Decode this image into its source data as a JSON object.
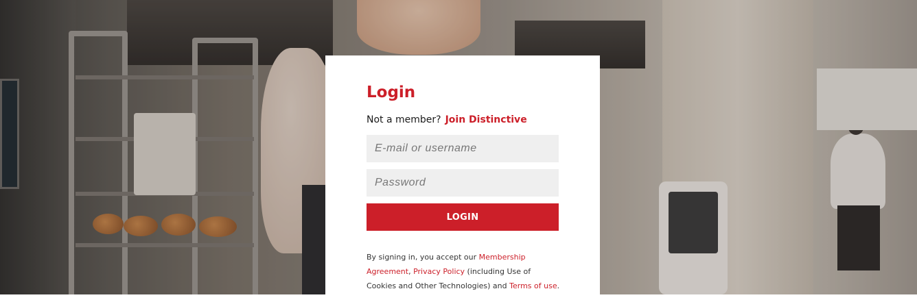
{
  "login": {
    "title": "Login",
    "not_member_text": "Not a member?",
    "join_link": "Join Distinctive",
    "email_placeholder": "E-mail or username",
    "password_placeholder": "Password",
    "button_label": "LOGIN"
  },
  "legal": {
    "prefix": "By signing in, you accept our ",
    "membership_link": "Membership Agreement",
    "comma": ", ",
    "privacy_link": "Privacy Policy",
    "middle": " (including Use of Cookies and Other Technologies) and ",
    "terms_link": "Terms of use",
    "suffix": "."
  },
  "colors": {
    "accent": "#cc1f29",
    "input_bg": "#efefef",
    "card_bg": "#ffffff"
  }
}
